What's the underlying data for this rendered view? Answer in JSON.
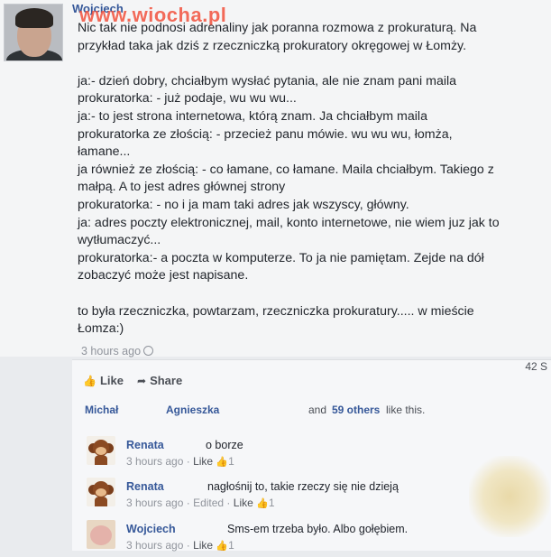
{
  "watermark": "www.wiocha.pl",
  "post": {
    "author": "Wojciech",
    "lines": [
      "Nic tak nie podnosi adrenaliny jak poranna rozmowa z prokuraturą. Na",
      "przykład taka jak dziś z rzeczniczką prokuratory okręgowej w Łomży.",
      "",
      "ja:- dzień dobry, chciałbym wysłać pytania, ale nie znam pani maila",
      "prokuratorka: - już podaje, wu wu wu...",
      "ja:- to jest strona internetowa, którą znam. Ja chciałbym maila",
      "prokuratorka ze złością: - przecież panu mówie. wu wu wu, łomża,",
      "łamane...",
      "ja również ze złością: - co łamane, co łamane. Maila chciałbym. Takiego z",
      "małpą. A to jest adres głównej strony",
      "prokuratorka: - no i ja mam taki adres jak wszyscy, główny.",
      "ja: adres poczty elektronicznej, mail, konto internetowe, nie wiem juz jak to",
      "wytłumaczyć...",
      "prokuratorka:- a poczta w komputerze. To ja nie pamiętam. Zejde na dół",
      "zobaczyć może jest napisane.",
      "",
      "to była rzeczniczka, powtarzam, rzeczniczka prokuratury..... w mieście",
      "Łomza:)"
    ],
    "time": "3 hours ago"
  },
  "actions": {
    "like_label": "Like",
    "share_label": "Share",
    "count_partial": "42 S"
  },
  "likes": {
    "name1": "Michał",
    "name2": "Agnieszka",
    "and": "and",
    "others": "59 others",
    "suffix": "like this."
  },
  "comments": [
    {
      "author": "Renata",
      "text": "o borze",
      "time": "3 hours ago",
      "edited": "",
      "like": "Like",
      "count": "1",
      "avatar": "monkey-avatar"
    },
    {
      "author": "Renata",
      "text": "nagłośnij to, takie rzeczy się nie dzieją",
      "time": "3 hours ago",
      "edited": "Edited",
      "like": "Like",
      "count": "1",
      "avatar": "monkey-avatar"
    },
    {
      "author": "Wojciech",
      "text": "Sms-em trzeba było. Albo gołębiem.",
      "time": "3 hours ago",
      "edited": "",
      "like": "Like",
      "count": "1",
      "avatar": "sheep-avatar"
    }
  ]
}
